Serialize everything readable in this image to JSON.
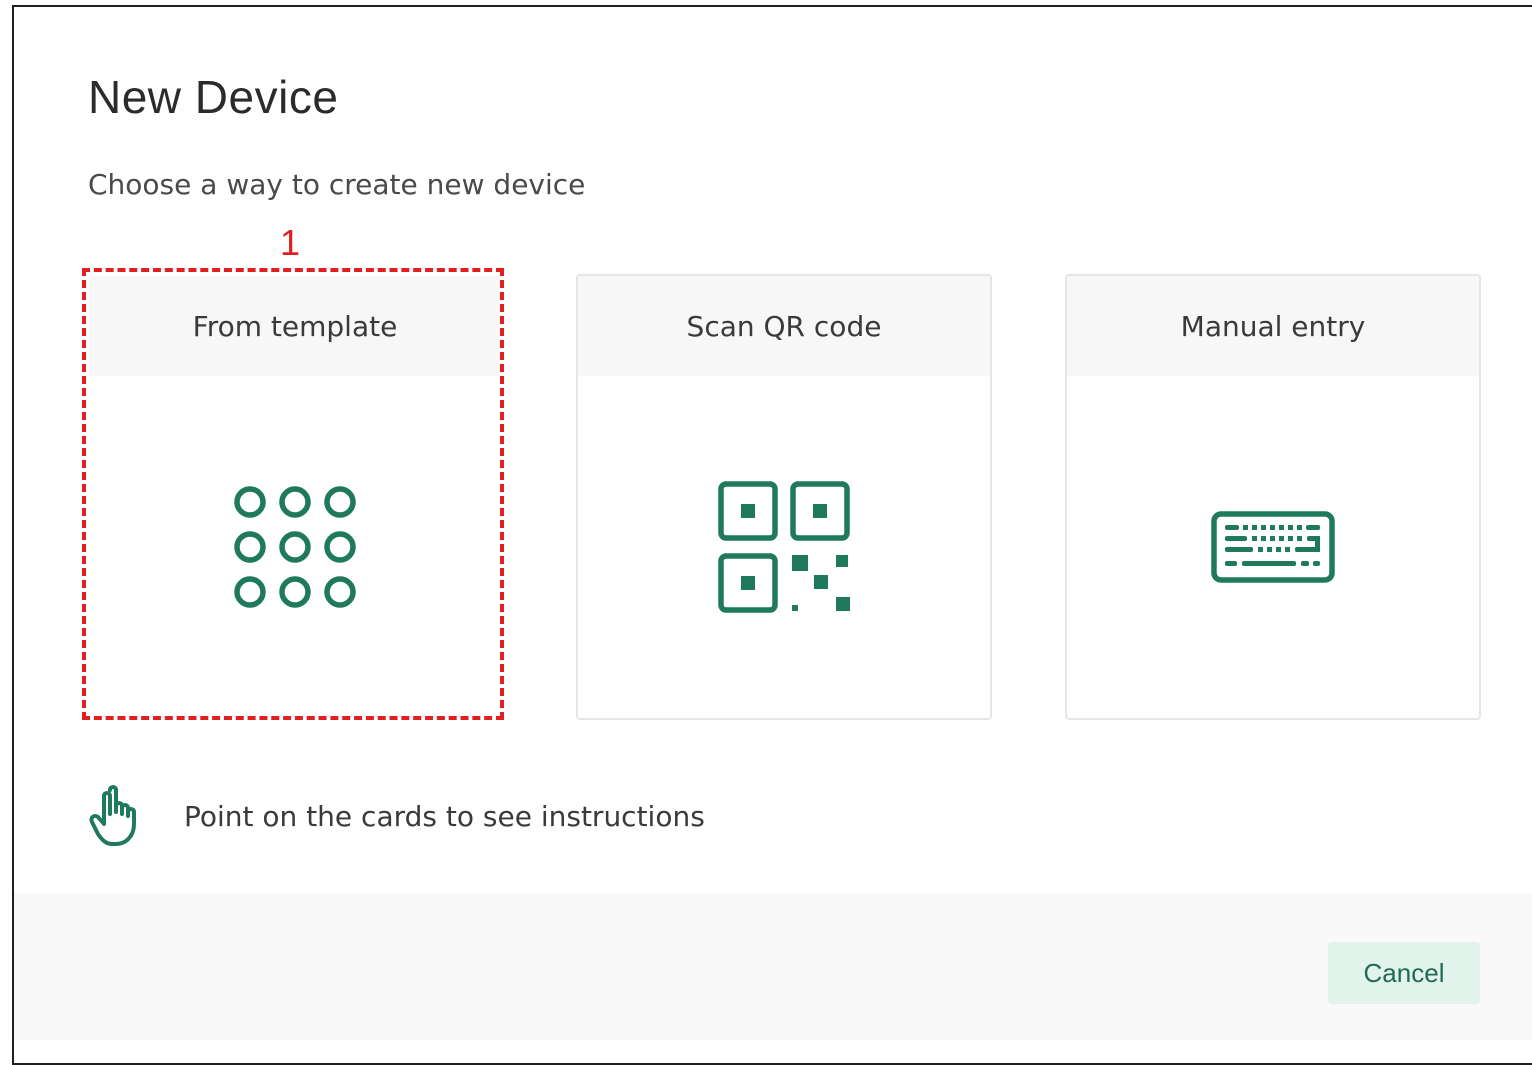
{
  "dialog": {
    "title": "New Device",
    "subtitle": "Choose a way to create new device",
    "annotation_number": "1",
    "cards": [
      {
        "label": "From template",
        "icon": "grid-dots-icon"
      },
      {
        "label": "Scan QR code",
        "icon": "qr-code-icon"
      },
      {
        "label": "Manual entry",
        "icon": "keyboard-icon"
      }
    ],
    "hint": {
      "text": "Point on the cards to see instructions",
      "icon": "pointing-hand-icon"
    },
    "footer": {
      "cancel_label": "Cancel"
    }
  },
  "colors": {
    "accent": "#1f7a5c",
    "highlight": "#e02020",
    "cancel_bg": "#e2f3ec",
    "cancel_text": "#1f6b55"
  }
}
